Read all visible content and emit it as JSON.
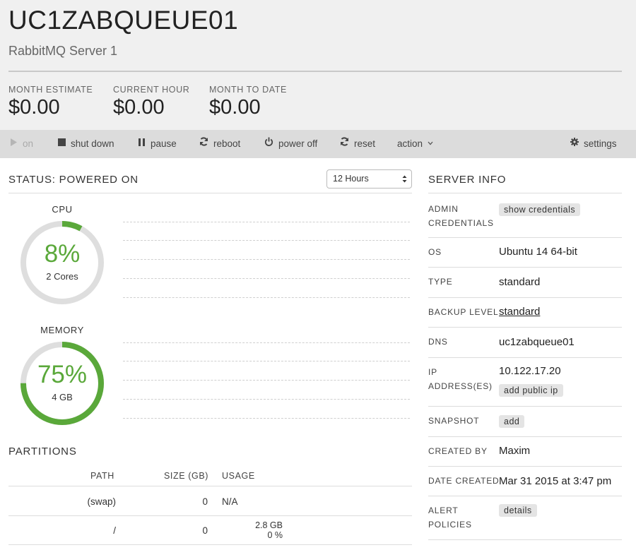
{
  "server": {
    "name": "UC1ZABQUEUE01",
    "description": "RabbitMQ Server 1"
  },
  "costs": [
    {
      "label": "MONTH ESTIMATE",
      "value": "$0.00"
    },
    {
      "label": "CURRENT HOUR",
      "value": "$0.00"
    },
    {
      "label": "MONTH TO DATE",
      "value": "$0.00"
    }
  ],
  "toolbar": {
    "on": "on",
    "shut_down": "shut down",
    "pause": "pause",
    "reboot": "reboot",
    "power_off": "power off",
    "reset": "reset",
    "action": "action",
    "settings": "settings"
  },
  "status": {
    "title": "STATUS: POWERED ON",
    "range": "12 Hours"
  },
  "cpu": {
    "label": "CPU",
    "percent": "8%",
    "sub": "2 Cores",
    "fraction": 0.08
  },
  "memory": {
    "label": "MEMORY",
    "percent": "75%",
    "sub": "4 GB",
    "fraction": 0.75
  },
  "partitions": {
    "title": "PARTITIONS",
    "headers": {
      "path": "PATH",
      "size": "SIZE (GB)",
      "usage": "USAGE"
    },
    "rows": [
      {
        "path": "(swap)",
        "size": "0",
        "usage": "N/A",
        "usage2": ""
      },
      {
        "path": "/",
        "size": "0",
        "usage": "2.8 GB",
        "usage2": "0 %"
      }
    ]
  },
  "server_info": {
    "title": "SERVER INFO",
    "admin_label_1": "ADMIN",
    "admin_label_2": "CREDENTIALS",
    "show_credentials": "show credentials",
    "os_label": "OS",
    "os": "Ubuntu 14 64-bit",
    "type_label": "TYPE",
    "type": "standard",
    "backup_label": "BACKUP LEVEL",
    "backup": "standard",
    "dns_label": "DNS",
    "dns": "uc1zabqueue01",
    "ip_label_1": "IP",
    "ip_label_2": "ADDRESS(ES)",
    "ip": "10.122.17.20",
    "add_public_ip": "add public ip",
    "snapshot_label": "SNAPSHOT",
    "snapshot_add": "add",
    "created_by_label": "CREATED BY",
    "created_by": "Maxim",
    "date_created_label": "DATE CREATED",
    "date_created": "Mar 31 2015 at 3:47 pm",
    "alert_label_1": "ALERT",
    "alert_label_2": "POLICIES",
    "alert_details": "details"
  },
  "colors": {
    "accent": "#5aa83a",
    "track": "#dedede",
    "header_bg": "#f0f0f0",
    "toolbar_bg": "#dcdcdc"
  }
}
